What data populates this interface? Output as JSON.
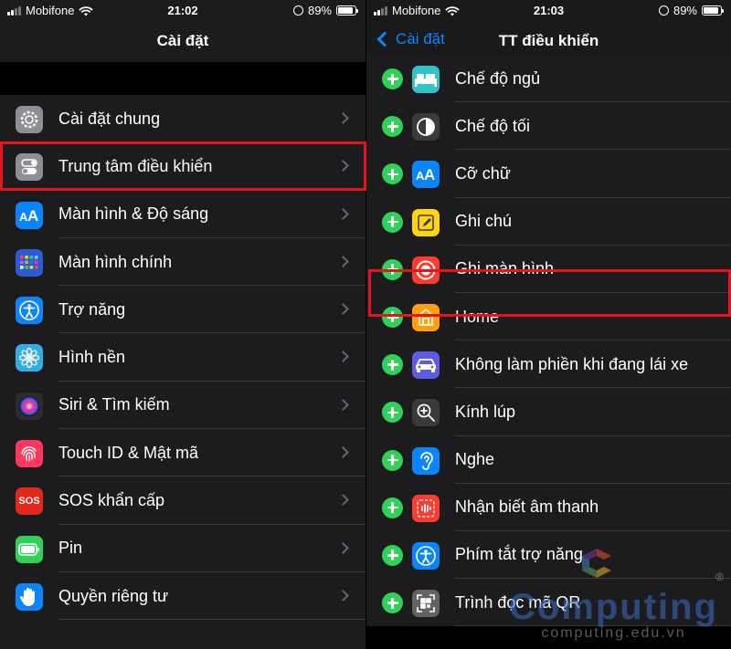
{
  "left_screen": {
    "status": {
      "carrier": "Mobifone",
      "time": "21:02",
      "battery": "89%",
      "battery_level": 0.89
    },
    "nav": {
      "title": "Cài đặt"
    },
    "items": [
      {
        "label": "Cài đặt chung",
        "icon": "gear-icon",
        "color": "#8e8e93"
      },
      {
        "label": "Trung tâm điều khiển",
        "icon": "toggles-icon",
        "color": "#8e8e93"
      },
      {
        "label": "Màn hình & Độ sáng",
        "icon": "text-size-icon",
        "color": "#0a84ff"
      },
      {
        "label": "Màn hình chính",
        "icon": "home-grid-icon",
        "color": "#2c5bd8"
      },
      {
        "label": "Trợ năng",
        "icon": "accessibility-icon",
        "color": "#0a84ff"
      },
      {
        "label": "Hình nền",
        "icon": "flower-icon",
        "color": "#32ade6"
      },
      {
        "label": "Siri & Tìm kiếm",
        "icon": "siri-icon",
        "color": "#2c2c2e"
      },
      {
        "label": "Touch ID & Mật mã",
        "icon": "fingerprint-icon",
        "color": "#ff375f"
      },
      {
        "label": "SOS khẩn cấp",
        "icon": "sos-icon",
        "color": "#e5261b",
        "icon_text": "SOS"
      },
      {
        "label": "Pin",
        "icon": "battery-icon",
        "color": "#30d158"
      },
      {
        "label": "Quyền riêng tư",
        "icon": "hand-icon",
        "color": "#0a84ff"
      }
    ]
  },
  "right_screen": {
    "status": {
      "carrier": "Mobifone",
      "time": "21:03",
      "battery": "89%",
      "battery_level": 0.89
    },
    "nav": {
      "back_label": "Cài đặt",
      "title": "TT điều khiển"
    },
    "items": [
      {
        "label": "Chế độ ngủ",
        "icon": "bed-icon",
        "color": "#32c2c8"
      },
      {
        "label": "Chế độ tối",
        "icon": "dark-mode-icon",
        "color": "#3a3a3c"
      },
      {
        "label": "Cỡ chữ",
        "icon": "text-size-icon",
        "color": "#0a84ff"
      },
      {
        "label": "Ghi chú",
        "icon": "notes-icon",
        "color": "#ffd60a"
      },
      {
        "label": "Ghi màn hình",
        "icon": "screen-record-icon",
        "color": "#ff3b30"
      },
      {
        "label": "Home",
        "icon": "home-icon",
        "color": "#ff9f0a"
      },
      {
        "label": "Không làm phiền khi đang lái xe",
        "icon": "car-icon",
        "color": "#5e5ce6"
      },
      {
        "label": "Kính lúp",
        "icon": "magnifier-icon",
        "color": "#3a3a3c"
      },
      {
        "label": "Nghe",
        "icon": "ear-icon",
        "color": "#0a84ff"
      },
      {
        "label": "Nhận biết âm thanh",
        "icon": "sound-recognition-icon",
        "color": "#ff3b30"
      },
      {
        "label": "Phím tắt trợ năng",
        "icon": "accessibility-icon",
        "color": "#0a84ff"
      },
      {
        "label": "Trình đọc mã QR",
        "icon": "qr-code-icon",
        "color": "#636366"
      }
    ]
  },
  "watermark": {
    "brand": "Computing",
    "site": "computing.edu.vn"
  },
  "colors": {
    "highlight": "#e5161b",
    "ios_blue": "#0a84ff",
    "ios_green": "#30d158"
  }
}
